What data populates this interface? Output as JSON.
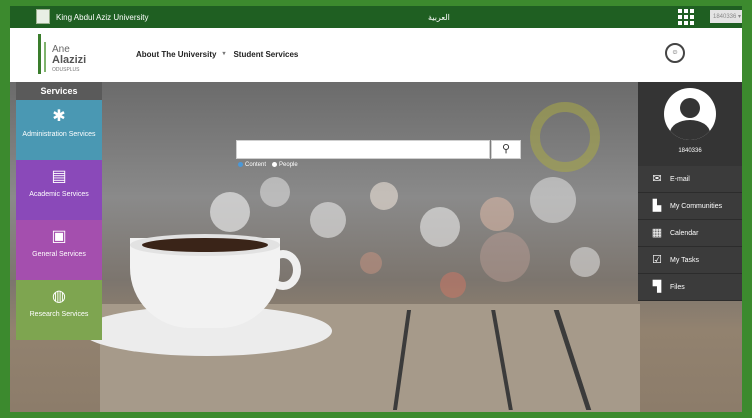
{
  "topbar": {
    "university_name": "King Abdul Aziz University",
    "arabic_link": "العربية",
    "user_menu": "1840336 ▾"
  },
  "header": {
    "logo_line1": "Ane",
    "logo_line2": "Alazizi",
    "logo_line3": "ODUSPLUS",
    "nav": [
      "About The University",
      "Student Services"
    ],
    "nav_caret": "▾"
  },
  "search": {
    "value": "",
    "placeholder": "",
    "button_icon": "search-icon",
    "scope_options": [
      "Content",
      "People"
    ]
  },
  "services": {
    "title": "Services",
    "items": [
      {
        "label": "Administration Services",
        "icon": "admin-icon",
        "color": "#4a98b3"
      },
      {
        "label": "Academic Services",
        "icon": "academic-icon",
        "color": "#8a49b9"
      },
      {
        "label": "General Services",
        "icon": "general-icon",
        "color": "#a44fae"
      },
      {
        "label": "Research Services",
        "icon": "research-icon",
        "color": "#7ea550"
      }
    ]
  },
  "profile": {
    "user_id": "1840336"
  },
  "quick_links": [
    {
      "label": "E-mail",
      "icon": "mail-icon"
    },
    {
      "label": "My Communities",
      "icon": "communities-icon"
    },
    {
      "label": "Calendar",
      "icon": "calendar-icon"
    },
    {
      "label": "My Tasks",
      "icon": "tasks-icon"
    },
    {
      "label": "Files",
      "icon": "files-icon"
    }
  ],
  "colors": {
    "topbar": "#1f5f22",
    "frame": "#3c8a2e",
    "sidebar_dark": "#3b3b3b"
  }
}
